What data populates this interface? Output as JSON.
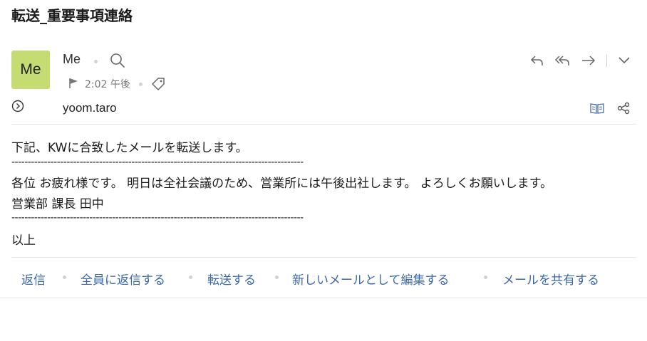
{
  "subject": "転送_重要事項連絡",
  "sender": {
    "avatar_initials": "Me",
    "name": "Me",
    "avatar_color": "#c4dc72"
  },
  "time": "2:02 午後",
  "recipient": "yoom.taro",
  "body": {
    "intro": "下記、KWに合致したメールを転送します。",
    "separator": "------------------------------------------------------------------------------------------",
    "greeting_line": "各位 お疲れ様です。 明日は全社会議のため、営業所には午後出社します。 よろしくお願いします。",
    "signature": "営業部 課長 田中",
    "closing": "以上"
  },
  "actions": {
    "reply": "返信",
    "reply_all": "全員に返信する",
    "forward": "転送する",
    "edit_as_new": "新しいメールとして編集する",
    "share": "メールを共有する"
  },
  "icons": {
    "search": "search-icon",
    "flag": "flag-icon",
    "tag": "tag-icon",
    "expand": "chevron-circle-icon",
    "reply": "reply-icon",
    "reply_all": "reply-all-icon",
    "forward": "forward-icon",
    "more": "chevron-down-icon",
    "reader": "book-icon",
    "share": "share-icon"
  },
  "colors": {
    "link": "#3b68ad",
    "avatar": "#c4dc72"
  }
}
